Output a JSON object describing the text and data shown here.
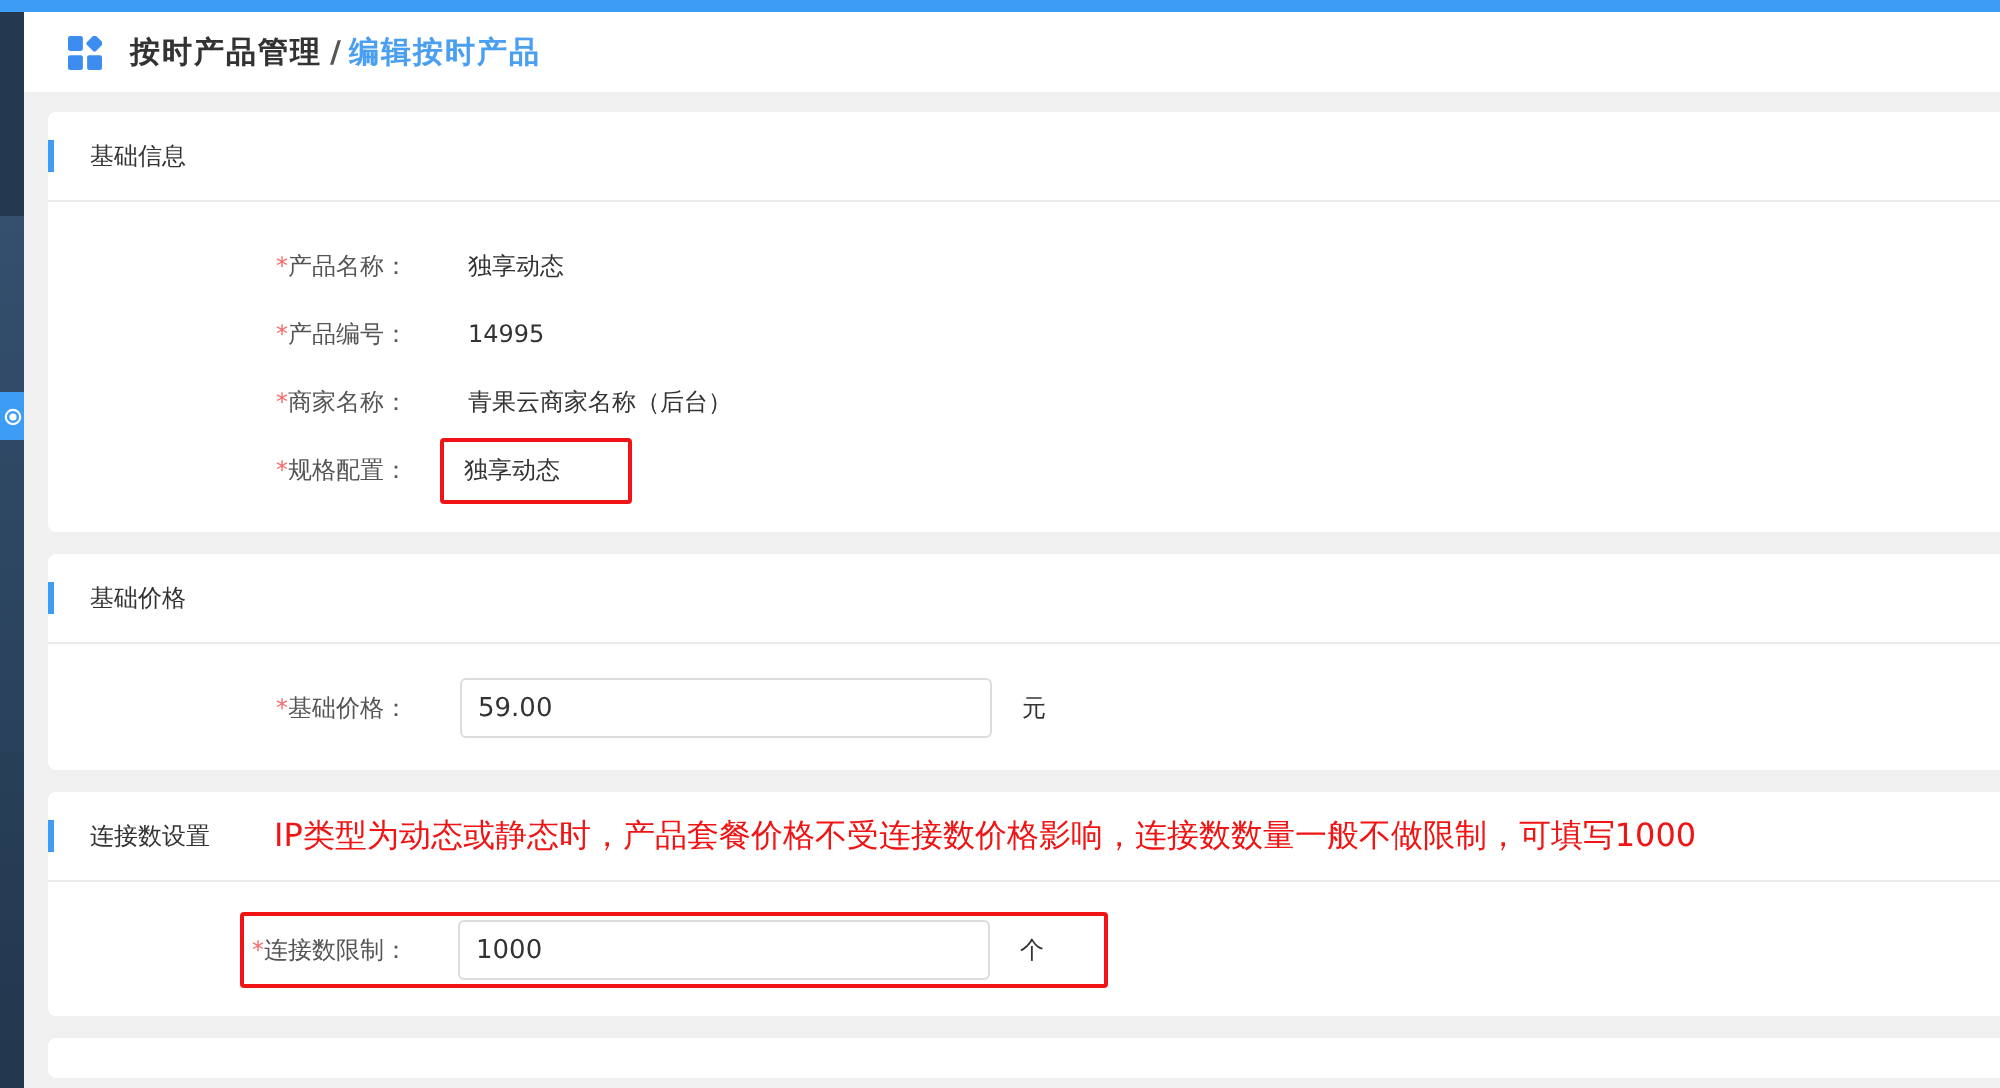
{
  "breadcrumb": {
    "parent": "按时产品管理",
    "separator": "/",
    "current": "编辑按时产品"
  },
  "sections": [
    {
      "title": "基础信息",
      "fields": [
        {
          "kind": "text",
          "mark": "*",
          "label": "产品名称：",
          "value": "独享动态",
          "annotated": false
        },
        {
          "kind": "text",
          "mark": "*",
          "label": "产品编号：",
          "value": "14995",
          "annotated": false
        },
        {
          "kind": "text",
          "mark": "*",
          "label": "商家名称：",
          "value": "青果云商家名称（后台）",
          "annotated": false
        },
        {
          "kind": "text",
          "mark": "*",
          "label": "规格配置：",
          "value": "独享动态",
          "annotated": true
        }
      ]
    },
    {
      "title": "基础价格",
      "fields": [
        {
          "kind": "input",
          "mark": "*",
          "label": "基础价格：",
          "value": "59.00",
          "unit": "元",
          "annotated": false
        }
      ]
    },
    {
      "title": "连接数设置",
      "note": "IP类型为动态或静态时，产品套餐价格不受连接数价格影响，连接数数量一般不做限制，可填写1000",
      "fields": [
        {
          "kind": "input",
          "mark": "*",
          "label": "连接数限制：",
          "value": "1000",
          "unit": "个",
          "annotated": true
        }
      ]
    }
  ]
}
